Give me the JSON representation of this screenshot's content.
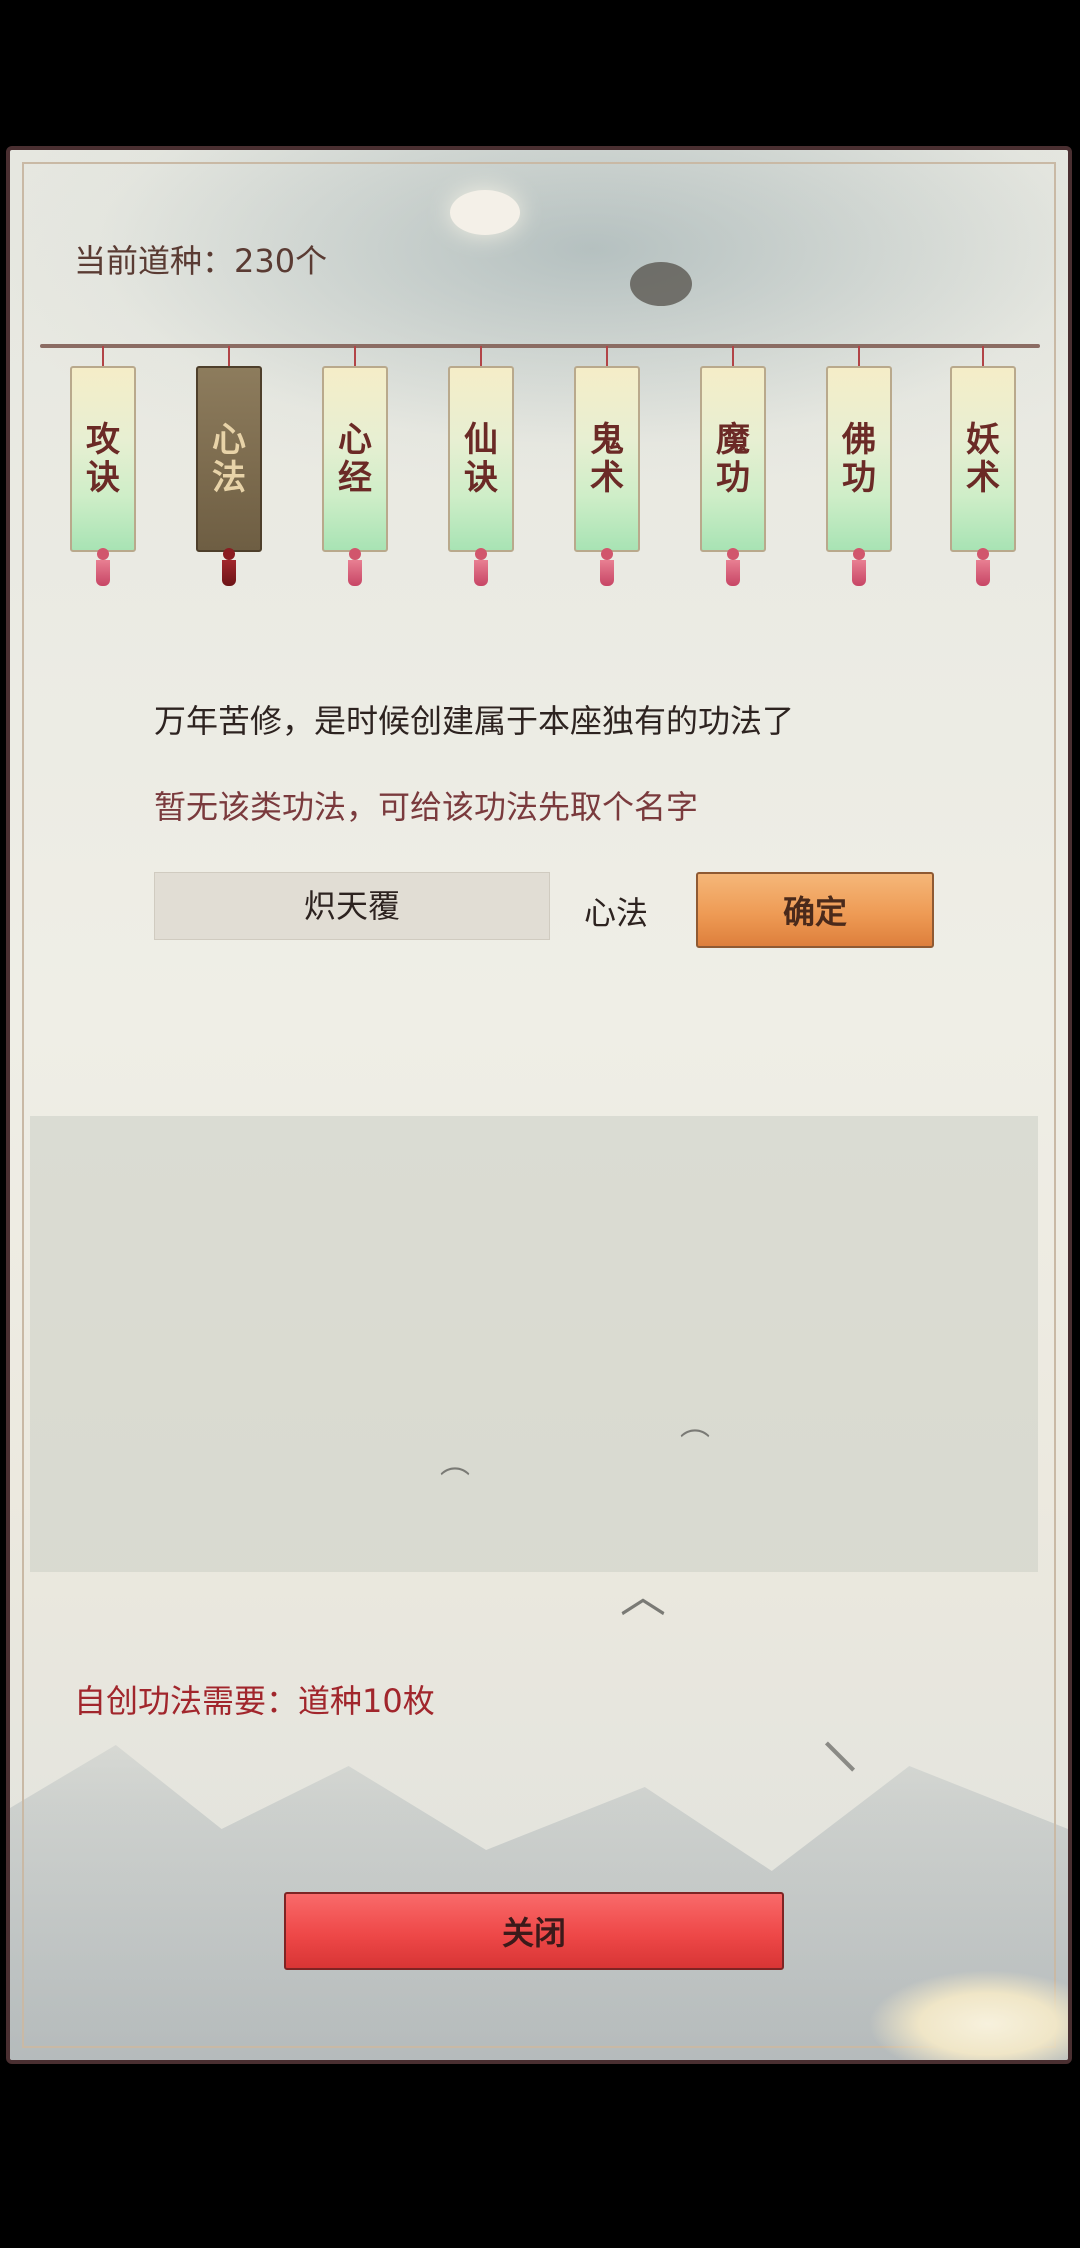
{
  "header": {
    "seeds_label": "当前道种：230个"
  },
  "categories": [
    {
      "label": "攻诀",
      "selected": false
    },
    {
      "label": "心法",
      "selected": true
    },
    {
      "label": "心经",
      "selected": false
    },
    {
      "label": "仙诀",
      "selected": false
    },
    {
      "label": "鬼术",
      "selected": false
    },
    {
      "label": "魔功",
      "selected": false
    },
    {
      "label": "佛功",
      "selected": false
    },
    {
      "label": "妖术",
      "selected": false
    }
  ],
  "create": {
    "intro": "万年苦修，是时候创建属于本座独有的功法了",
    "hint": "暂无该类功法，可给该功法先取个名字",
    "name_value": "炽天覆",
    "category_label": "心法",
    "confirm_label": "确定"
  },
  "footer": {
    "cost_label": "自创功法需要：道种10枚",
    "close_label": "关闭"
  },
  "colors": {
    "selected_tag": "#7b6a4d",
    "confirm": "#ee9b55",
    "close": "#ee4848",
    "cost_text": "#a1262c"
  }
}
